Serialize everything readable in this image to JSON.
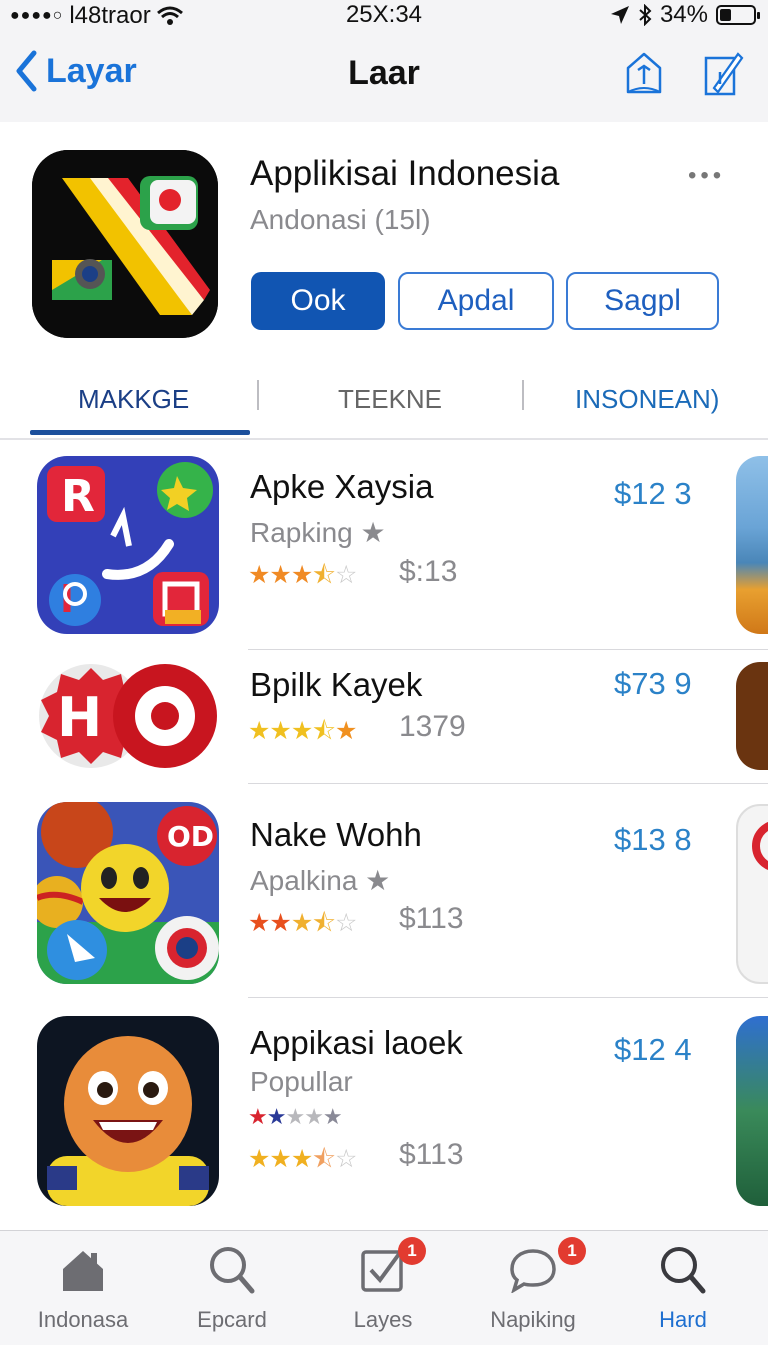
{
  "status_bar": {
    "carrier": "l48traor",
    "time": "25X:34",
    "battery_text": "34%",
    "battery_level": 0.34
  },
  "nav": {
    "back_label": "Layar",
    "title": "Laar",
    "icons": [
      "share-icon",
      "compose-icon"
    ]
  },
  "hero": {
    "title": "Applikisai Indonesia",
    "subtitle": "Andonasi (15l)",
    "buttons": {
      "primary": "Ook",
      "secondary": "Apdal",
      "tertiary": "Sagpl"
    }
  },
  "tabs": [
    "MAKKGE",
    "TEEKNE",
    "INSONEAN)"
  ],
  "apps": [
    {
      "title": "Apke Xaysia",
      "subtitle": "Rapking ★",
      "rating": 3.5,
      "rating_text": "$:13",
      "price": "$12 3",
      "icon": "music-social-app-icon"
    },
    {
      "title": "Bpilk Kayek",
      "subtitle": "",
      "rating": 4.5,
      "rating_text": "1379",
      "price": "$73 9",
      "icon": "ho-app-icon"
    },
    {
      "title": "Nake Wohh",
      "subtitle": "Apalkina ★",
      "rating": 3.5,
      "rating_text": "$113",
      "price": "$13 8",
      "icon": "emoji-game-app-icon"
    },
    {
      "title": "Appikasi laoek",
      "subtitle": "Popullar",
      "rating": 3.5,
      "rating_text": "$113",
      "price": "$12 4",
      "icon": "character-game-app-icon"
    }
  ],
  "tab_bar": [
    {
      "label": "Indonasa",
      "icon": "home-icon"
    },
    {
      "label": "Epcard",
      "icon": "search-icon"
    },
    {
      "label": "Layes",
      "icon": "checkbox-icon",
      "badge": "1"
    },
    {
      "label": "Napiking",
      "icon": "chat-bubble-icon",
      "badge": "1"
    },
    {
      "label": "Hard",
      "icon": "search-icon",
      "active": true
    }
  ],
  "colors": {
    "accent": "#1a73d9",
    "primary_button": "#1155b2",
    "price": "#2b82c8",
    "badge": "#e23b30"
  }
}
